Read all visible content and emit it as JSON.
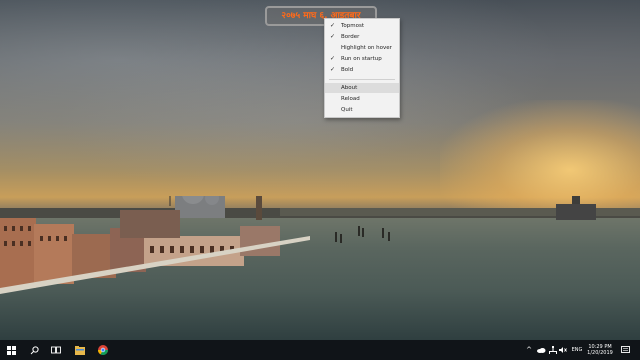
{
  "clock": {
    "text": "२०७५ माघ ६, आइतबार"
  },
  "context_menu": {
    "items": [
      {
        "label": "Topmost",
        "checked": true
      },
      {
        "label": "Border",
        "checked": true
      },
      {
        "label": "Highlight on hover",
        "checked": false
      },
      {
        "label": "Run on startup",
        "checked": true
      },
      {
        "label": "Bold",
        "checked": true
      },
      {
        "label": "About",
        "checked": false,
        "highlighted": true
      },
      {
        "label": "Reload",
        "checked": false
      },
      {
        "label": "Quit",
        "checked": false
      }
    ]
  },
  "taskbar": {
    "icons": [
      "windows-start-icon",
      "search-icon",
      "task-view-icon",
      "file-explorer-icon",
      "chrome-icon"
    ],
    "tray": {
      "icons": [
        "chevron-up-icon",
        "onedrive-cloud-icon",
        "network-icon",
        "volume-icon"
      ],
      "language": "ENG",
      "time": "10:29 PM",
      "date": "1/20/2019",
      "notification_icon": "action-center-icon"
    }
  },
  "colors": {
    "clock_text": "#ff6a1a",
    "taskbar": "#101418",
    "menu_bg": "#f2f2f2"
  }
}
